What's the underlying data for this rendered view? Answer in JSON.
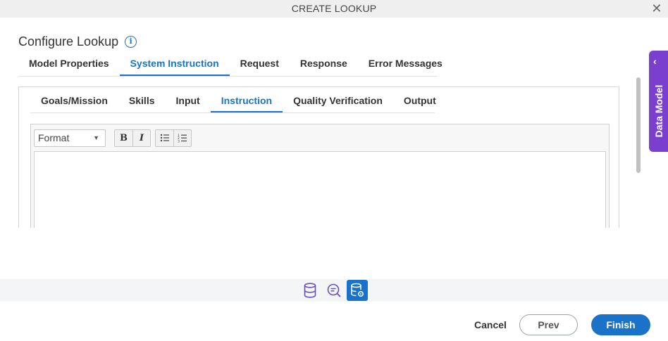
{
  "dialog": {
    "title": "CREATE LOOKUP",
    "close_icon": "close-icon"
  },
  "heading": {
    "title": "Configure Lookup",
    "info_icon": "info-icon"
  },
  "main_tabs": [
    {
      "label": "Model Properties",
      "active": false
    },
    {
      "label": "System Instruction",
      "active": true
    },
    {
      "label": "Request",
      "active": false
    },
    {
      "label": "Response",
      "active": false
    },
    {
      "label": "Error Messages",
      "active": false
    }
  ],
  "sub_tabs": [
    {
      "label": "Goals/Mission",
      "active": false
    },
    {
      "label": "Skills",
      "active": false
    },
    {
      "label": "Input",
      "active": false
    },
    {
      "label": "Instruction",
      "active": true
    },
    {
      "label": "Quality Verification",
      "active": false
    },
    {
      "label": "Output",
      "active": false
    }
  ],
  "editor": {
    "format_value": "Format",
    "bold_label": "B",
    "italic_label": "I",
    "content": ""
  },
  "side_panel": {
    "label": "Data Model",
    "icon": "chevron-left-icon"
  },
  "steps": [
    {
      "icon": "database-icon",
      "active": false
    },
    {
      "icon": "search-chat-icon",
      "active": false
    },
    {
      "icon": "database-settings-icon",
      "active": true
    }
  ],
  "footer": {
    "cancel_label": "Cancel",
    "prev_label": "Prev",
    "finish_label": "Finish"
  },
  "colors": {
    "accent": "#1a73c8",
    "side_panel": "#7b3fd0",
    "step_icon": "#6b4fb8"
  }
}
